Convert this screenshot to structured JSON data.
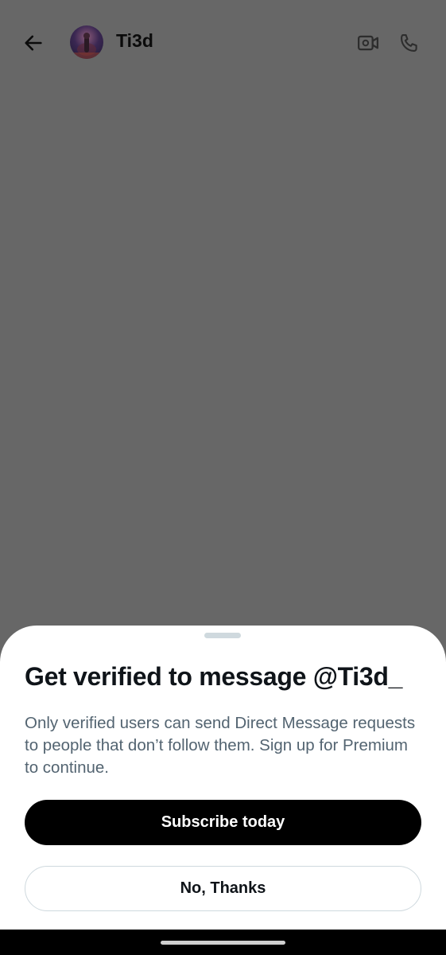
{
  "header": {
    "back_icon": "arrow-left-icon",
    "username": "Ti3d",
    "video_icon": "video-call-icon",
    "phone_icon": "phone-icon"
  },
  "sheet": {
    "title": "Get verified to message @Ti3d_",
    "description": "Only verified users can send Direct Message requests to people that don’t follow them. Sign up for Premium to continue.",
    "subscribe_label": "Subscribe today",
    "no_thanks_label": "No, Thanks"
  },
  "colors": {
    "overlay": "#676767",
    "sheet_bg": "#ffffff",
    "primary_button": "#000000",
    "secondary_text": "#536471",
    "border": "#cfd9de"
  }
}
